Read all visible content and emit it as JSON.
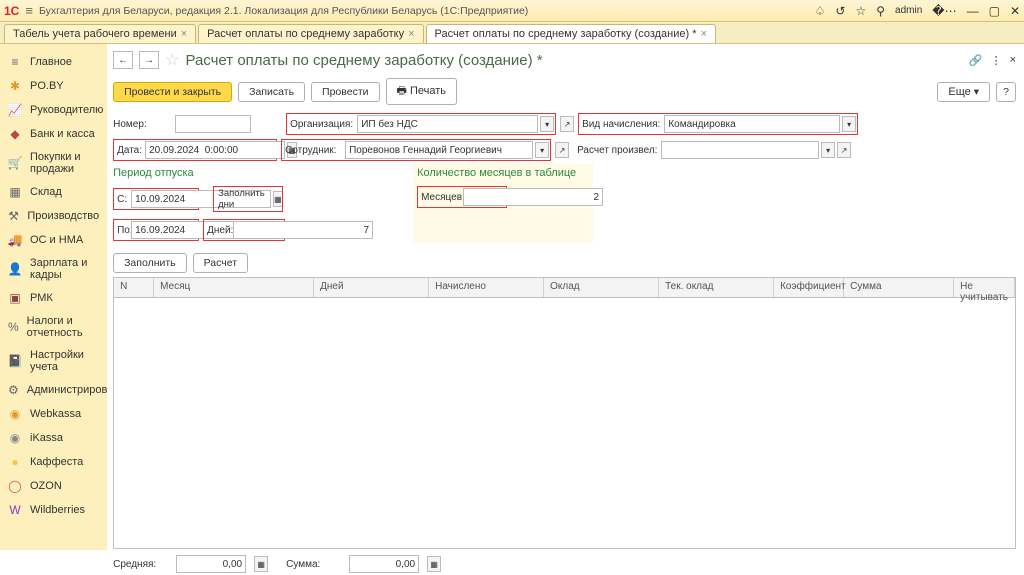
{
  "app": {
    "logo": "1С",
    "title": "Бухгалтерия для Беларуси, редакция 2.1. Локализация для Республики Беларусь  (1С:Предприятие)",
    "user": "admin"
  },
  "tabs": [
    {
      "label": "Табель учета рабочего времени"
    },
    {
      "label": "Расчет оплаты по среднему заработку"
    },
    {
      "label": "Расчет оплаты по среднему заработку (создание) *",
      "active": true
    }
  ],
  "sidebar": [
    {
      "icon": "≡",
      "label": "Главное",
      "color": "#666"
    },
    {
      "icon": "✱",
      "label": "PO.BY",
      "color": "#e39a2b"
    },
    {
      "icon": "📈",
      "label": "Руководителю",
      "color": "#7a4"
    },
    {
      "icon": "◆",
      "label": "Банк и касса",
      "color": "#b44"
    },
    {
      "icon": "🛒",
      "label": "Покупки и продажи",
      "color": "#844"
    },
    {
      "icon": "▦",
      "label": "Склад",
      "color": "#666"
    },
    {
      "icon": "⚒",
      "label": "Производство",
      "color": "#666"
    },
    {
      "icon": "🚚",
      "label": "ОС и НМА",
      "color": "#666"
    },
    {
      "icon": "👤",
      "label": "Зарплата и кадры",
      "color": "#666"
    },
    {
      "icon": "▣",
      "label": "РМК",
      "color": "#844"
    },
    {
      "icon": "%",
      "label": "Налоги и отчетность",
      "color": "#666"
    },
    {
      "icon": "📓",
      "label": "Настройки учета",
      "color": "#844"
    },
    {
      "icon": "⚙",
      "label": "Администрирование",
      "color": "#666"
    },
    {
      "icon": "◉",
      "label": "Webkassa",
      "color": "#e39a2b"
    },
    {
      "icon": "◉",
      "label": "iKassa",
      "color": "#888"
    },
    {
      "icon": "●",
      "label": "Каффеста",
      "color": "#f2c94c"
    },
    {
      "icon": "◯",
      "label": "OZON",
      "color": "#e44"
    },
    {
      "icon": "W",
      "label": "Wildberries",
      "color": "#8a3ab9"
    }
  ],
  "page": {
    "title": "Расчет оплаты по среднему заработку (создание) *",
    "commands": {
      "post_close": "Провести и закрыть",
      "save": "Записать",
      "post": "Провести",
      "print": "Печать",
      "more": "Еще",
      "help": "?"
    },
    "fields": {
      "number_label": "Номер:",
      "number": "",
      "org_label": "Организация:",
      "org": "ИП без НДС",
      "type_label": "Вид начисления:",
      "type": "Командировка",
      "date_label": "Дата:",
      "date": "20.09.2024  0:00:00",
      "emp_label": "Сотрудник:",
      "emp": "Поревонов Геннадий Георгиевич",
      "calc_by_label": "Расчет произвел:",
      "calc_by": ""
    },
    "period": {
      "section": "Период отпуска",
      "from_label": "С:",
      "from": "10.09.2024",
      "to_label": "По:",
      "to": "16.09.2024",
      "days_label": "Дней:",
      "days": "7",
      "fill_days": "Заполнить дни"
    },
    "months": {
      "section": "Количество месяцев в таблице",
      "label": "Месяцев:",
      "value": "2"
    },
    "table": {
      "fill": "Заполнить",
      "calc": "Расчет",
      "cols": [
        "N",
        "Месяц",
        "Дней",
        "Начислено",
        "Оклад",
        "Тек. оклад",
        "Коэффициент",
        "Сумма",
        "Не учитывать"
      ]
    },
    "footer": {
      "avg_label": "Средняя:",
      "avg": "0,00",
      "sum_label": "Сумма:",
      "sum": "0,00"
    }
  }
}
